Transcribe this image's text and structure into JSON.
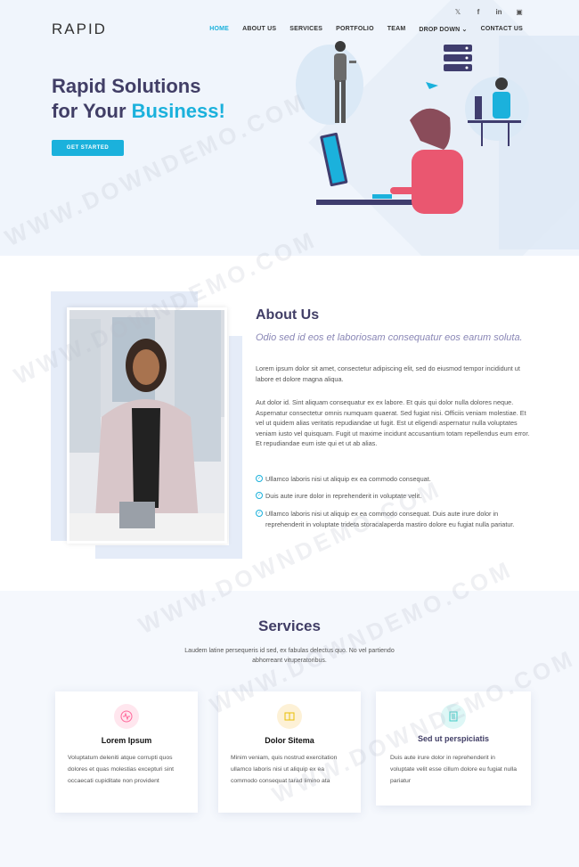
{
  "header": {
    "logo": "RAPID",
    "nav": [
      "HOME",
      "ABOUT US",
      "SERVICES",
      "PORTFOLIO",
      "TEAM",
      "DROP DOWN",
      "CONTACT US"
    ],
    "social": [
      "twitter-icon",
      "facebook-icon",
      "linkedin-icon",
      "instagram-icon"
    ]
  },
  "hero": {
    "title_line1": "Rapid Solutions",
    "title_line2_prefix": "for Your ",
    "title_highlight": "Business!",
    "button": "GET STARTED"
  },
  "about": {
    "title": "About Us",
    "lead": "Odio sed id eos et laboriosam consequatur eos earum soluta.",
    "p1": "Lorem ipsum dolor sit amet, consectetur adipiscing elit, sed do eiusmod tempor incididunt ut labore et dolore magna aliqua.",
    "p2": "Aut dolor id. Sint aliquam consequatur ex ex labore. Et quis qui dolor nulla dolores neque. Aspernatur consectetur omnis numquam quaerat. Sed fugiat nisi. Officiis veniam molestiae. Et vel ut quidem alias veritatis repudiandae ut fugit. Est ut eligendi aspernatur nulla voluptates veniam iusto vel quisquam. Fugit ut maxime incidunt accusantium totam repellendus eum error. Et repudiandae eum iste qui et ut ab alias.",
    "checks": [
      "Ullamco laboris nisi ut aliquip ex ea commodo consequat.",
      "Duis aute irure dolor in reprehenderit in voluptate velit.",
      "Ullamco laboris nisi ut aliquip ex ea commodo consequat. Duis aute irure dolor in reprehenderit in voluptate trideta storacalaperda mastiro dolore eu fugiat nulla pariatur."
    ]
  },
  "services": {
    "title": "Services",
    "subtitle": "Laudem latine persequeris id sed, ex fabulas delectus quo. No vel partiendo abhorreant vituperatoribus.",
    "cards": [
      {
        "title": "Lorem Ipsum",
        "text": "Voluptatum deleniti atque corrupti quos dolores et quas molestias excepturi sint occaecati cupiditate non provident",
        "icon": "pulse-icon",
        "color": "#ff689b"
      },
      {
        "title": "Dolor Sitema",
        "text": "Minim veniam, quis nostrud exercitation ullamco laboris nisi ut aliquip ex ea commodo consequat tarad limino ata",
        "icon": "book-icon",
        "color": "#e9bf06"
      },
      {
        "title": "Sed ut perspiciatis",
        "text": "Duis aute irure dolor in reprehenderit in voluptate velit esse cillum dolore eu fugiat nulla pariatur",
        "icon": "document-icon",
        "color": "#3fcdc7"
      }
    ]
  },
  "watermark": "WWW.DOWNDEMO.COM"
}
